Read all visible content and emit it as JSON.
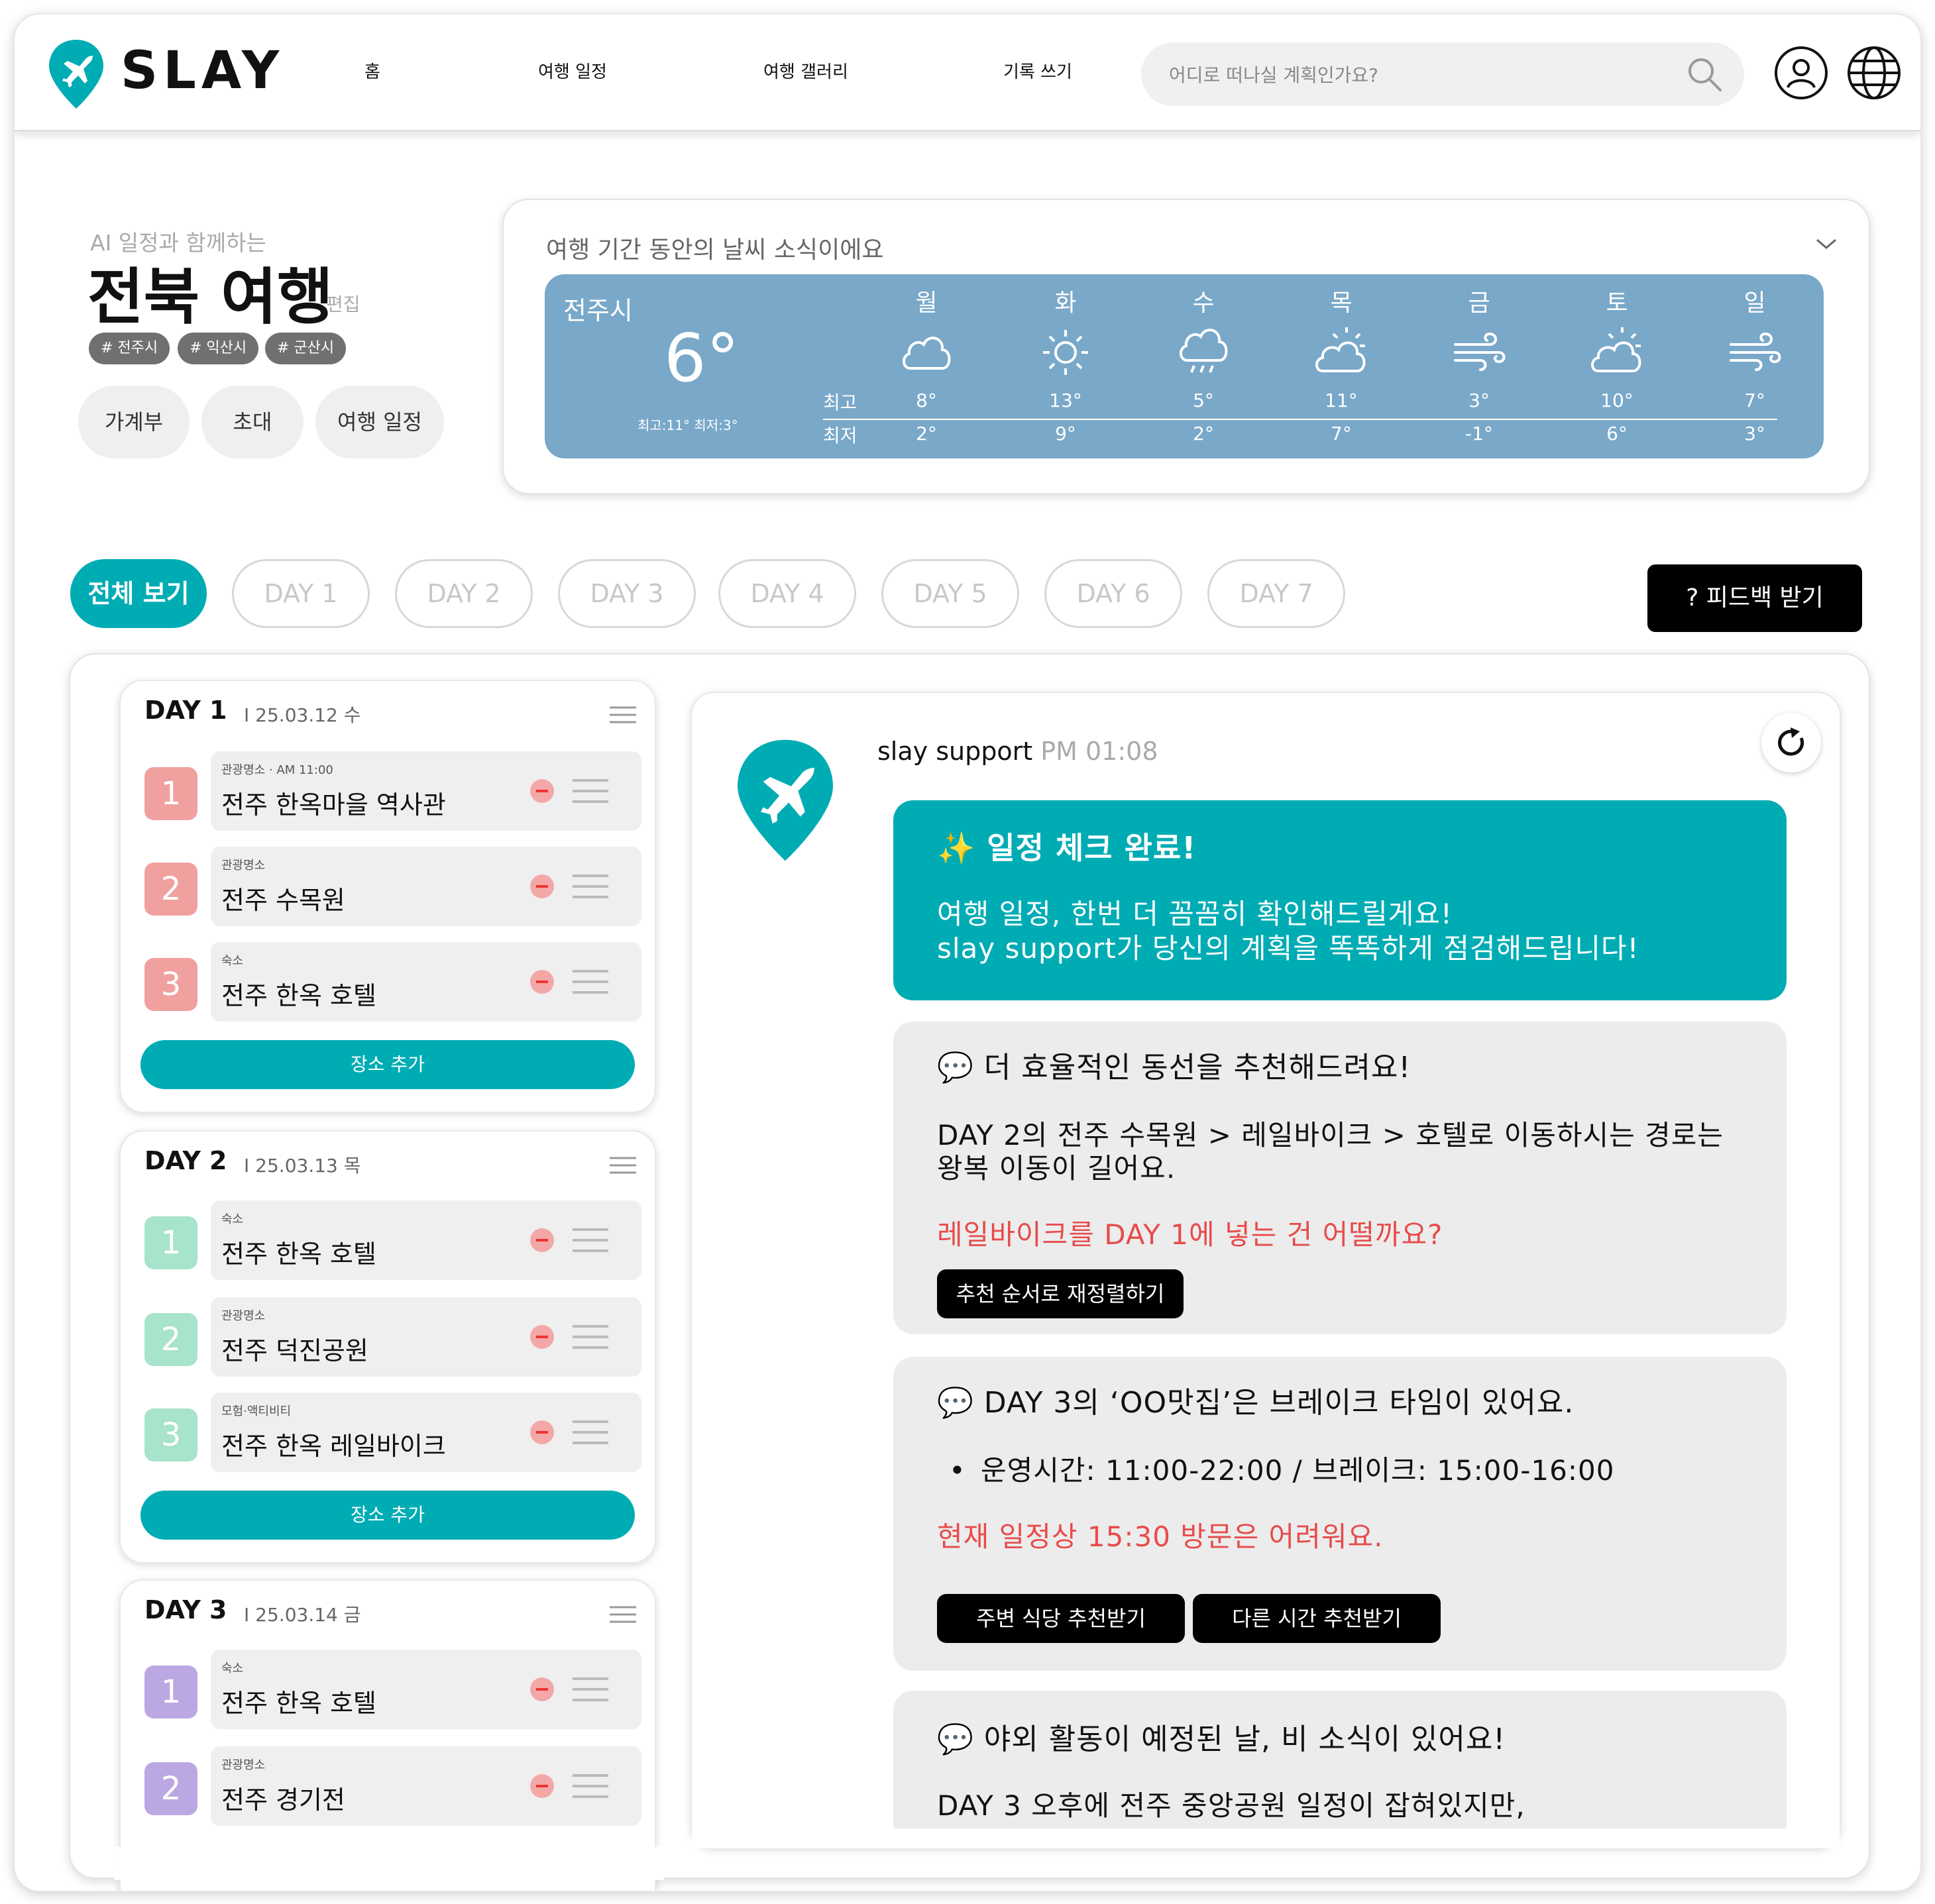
{
  "nav": {
    "brand": "SLAY",
    "links": [
      "홈",
      "여행 일정",
      "여행 갤러리",
      "기록 쓰기"
    ],
    "search_placeholder": "어디로 떠나실 계획인가요?"
  },
  "trip": {
    "subtitle": "AI 일정과 함께하는",
    "title": "전북 여행",
    "edit": "편집",
    "tags": [
      "# 전주시",
      "# 익산시",
      "# 군산시"
    ],
    "actions": [
      "가계부",
      "초대",
      "여행 일정"
    ]
  },
  "weather": {
    "heading": "여행 기간 동안의 날씨 소식이에요",
    "city": "전주시",
    "current_temp": "6°",
    "current_minmax": "최고:11° 최저:3°",
    "high_label": "최고",
    "low_label": "최저",
    "days": [
      {
        "day": "월",
        "icon": "cloud-icon",
        "high": "8°",
        "low": "2°"
      },
      {
        "day": "화",
        "icon": "sun-icon",
        "high": "13°",
        "low": "9°"
      },
      {
        "day": "수",
        "icon": "rain-cloud-icon",
        "high": "5°",
        "low": "2°"
      },
      {
        "day": "목",
        "icon": "partly-cloudy-icon",
        "high": "11°",
        "low": "7°"
      },
      {
        "day": "금",
        "icon": "wind-icon",
        "high": "3°",
        "low": "-1°"
      },
      {
        "day": "토",
        "icon": "partly-cloudy-icon",
        "high": "10°",
        "low": "6°"
      },
      {
        "day": "일",
        "icon": "wind-icon",
        "high": "7°",
        "low": "3°"
      }
    ]
  },
  "tabs": [
    "전체 보기",
    "DAY 1",
    "DAY 2",
    "DAY 3",
    "DAY 4",
    "DAY 5",
    "DAY 6",
    "DAY 7"
  ],
  "feedback_label": "? 피드백 받기",
  "schedule": [
    {
      "title": "DAY 1",
      "date": "I 25.03.12 수",
      "add_label": "장소 추가",
      "items": [
        {
          "num": "1",
          "category": "관광명소 · AM 11:00",
          "name": "전주 한옥마을 역사관"
        },
        {
          "num": "2",
          "category": "관광명소",
          "name": "전주 수목원"
        },
        {
          "num": "3",
          "category": "숙소",
          "name": "전주 한옥 호텔"
        }
      ]
    },
    {
      "title": "DAY 2",
      "date": "I 25.03.13 목",
      "add_label": "장소 추가",
      "items": [
        {
          "num": "1",
          "category": "숙소",
          "name": "전주 한옥 호텔"
        },
        {
          "num": "2",
          "category": "관광명소",
          "name": "전주 덕진공원"
        },
        {
          "num": "3",
          "category": "모험·액티비티",
          "name": "전주 한옥 레일바이크"
        }
      ]
    },
    {
      "title": "DAY 3",
      "date": "I 25.03.14 금",
      "items": [
        {
          "num": "1",
          "category": "숙소",
          "name": "전주 한옥 호텔"
        },
        {
          "num": "2",
          "category": "관광명소",
          "name": "전주 경기전"
        }
      ]
    }
  ],
  "colors": {
    "accent": "#00acb4",
    "day1": "#f1a0a0",
    "day2": "#a8e3cc",
    "day3": "#bba8e2",
    "weather_panel": "#79a8c9",
    "warning": "#e84b4b"
  },
  "chat": {
    "sender": "slay support",
    "time": "PM 01:08",
    "check_title": "✨ 일정 체크 완료!",
    "check_line1": "여행 일정, 한번 더 꼼꼼히 확인해드릴게요!",
    "check_line2": "slay support가 당신의 계획을 똑똑하게 점검해드립니다!",
    "route_title": "💬 더 효율적인 동선을 추천해드려요!",
    "route_line1": "DAY 2의 전주 수목원 > 레일바이크 > 호텔로 이동하시는 경로는",
    "route_line2": "왕복 이동이 길어요.",
    "route_suggest": "레일바이크를 DAY 1에 넣는 건 어떨까요?",
    "route_button": "추천 순서로 재정렬하기",
    "break_title": "💬 DAY 3의 ‘OO맛집’은 브레이크 타임이 있어요.",
    "break_hours": "운영시간: 11:00-22:00 / 브레이크: 15:00-16:00",
    "break_warning": "현재 일정상 15:30 방문은 어려워요.",
    "break_button1": "주변 식당 추천받기",
    "break_button2": "다른 시간 추천받기",
    "rain_title": "💬 야외 활동이 예정된 날, 비 소식이 있어요!",
    "rain_line1": "DAY 3 오후에 전주 중앙공원 일정이 잡혀있지만,"
  }
}
